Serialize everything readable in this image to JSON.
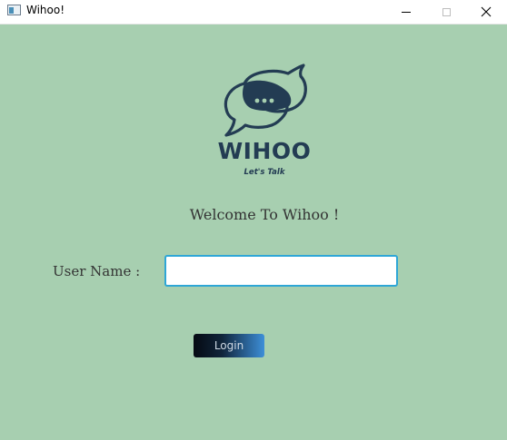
{
  "window": {
    "title": "Wihoo!",
    "icon": "app-window-icon",
    "controls": [
      "minimize-icon",
      "maximize-icon",
      "close-icon"
    ]
  },
  "logo": {
    "icon": "chat-bubbles-icon",
    "wordmark": "WIHOO",
    "tagline": "Let's Talk"
  },
  "main": {
    "welcome_text": "Welcome To Wihoo !",
    "username_label": "User Name :",
    "username_value": "",
    "username_placeholder": "",
    "login_label": "Login"
  },
  "colors": {
    "background": "#a7cfb0",
    "logo": "#233c53",
    "input_border": "#2ea6d6",
    "button_gradient_start": "#050a12",
    "button_gradient_end": "#3d8fd8"
  }
}
